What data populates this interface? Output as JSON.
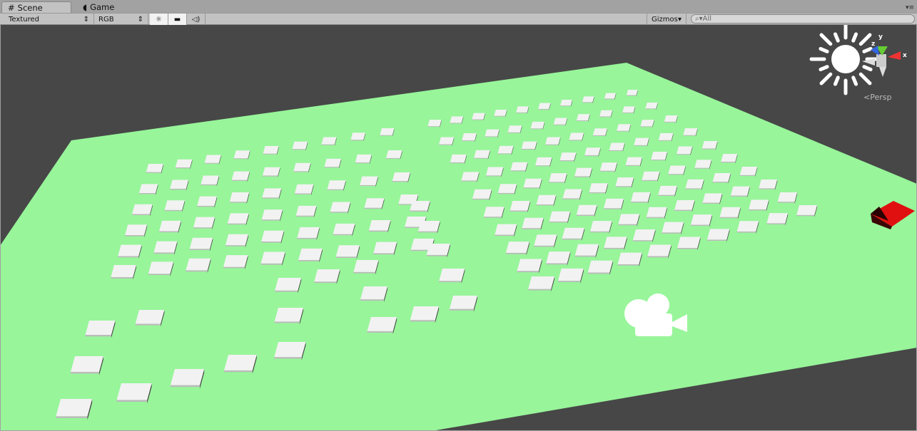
{
  "tabs": [
    {
      "label": "Scene",
      "icon": "grid-icon"
    },
    {
      "label": "Game",
      "icon": "pacman-icon"
    }
  ],
  "toolbar": {
    "draw_mode": "Textured",
    "render_mode": "RGB",
    "lighting_on": true,
    "image_effects_on": true,
    "audio_on": false,
    "gizmos_label": "Gizmos",
    "search_placeholder": "All"
  },
  "scene": {
    "projection_label": "Persp",
    "gizmo_axes": {
      "x": "x",
      "y": "y",
      "z": "z"
    },
    "colors": {
      "ground": "#98f59a",
      "background": "#474747",
      "tile": "#f2f2f2",
      "cube": "#e01010"
    }
  }
}
